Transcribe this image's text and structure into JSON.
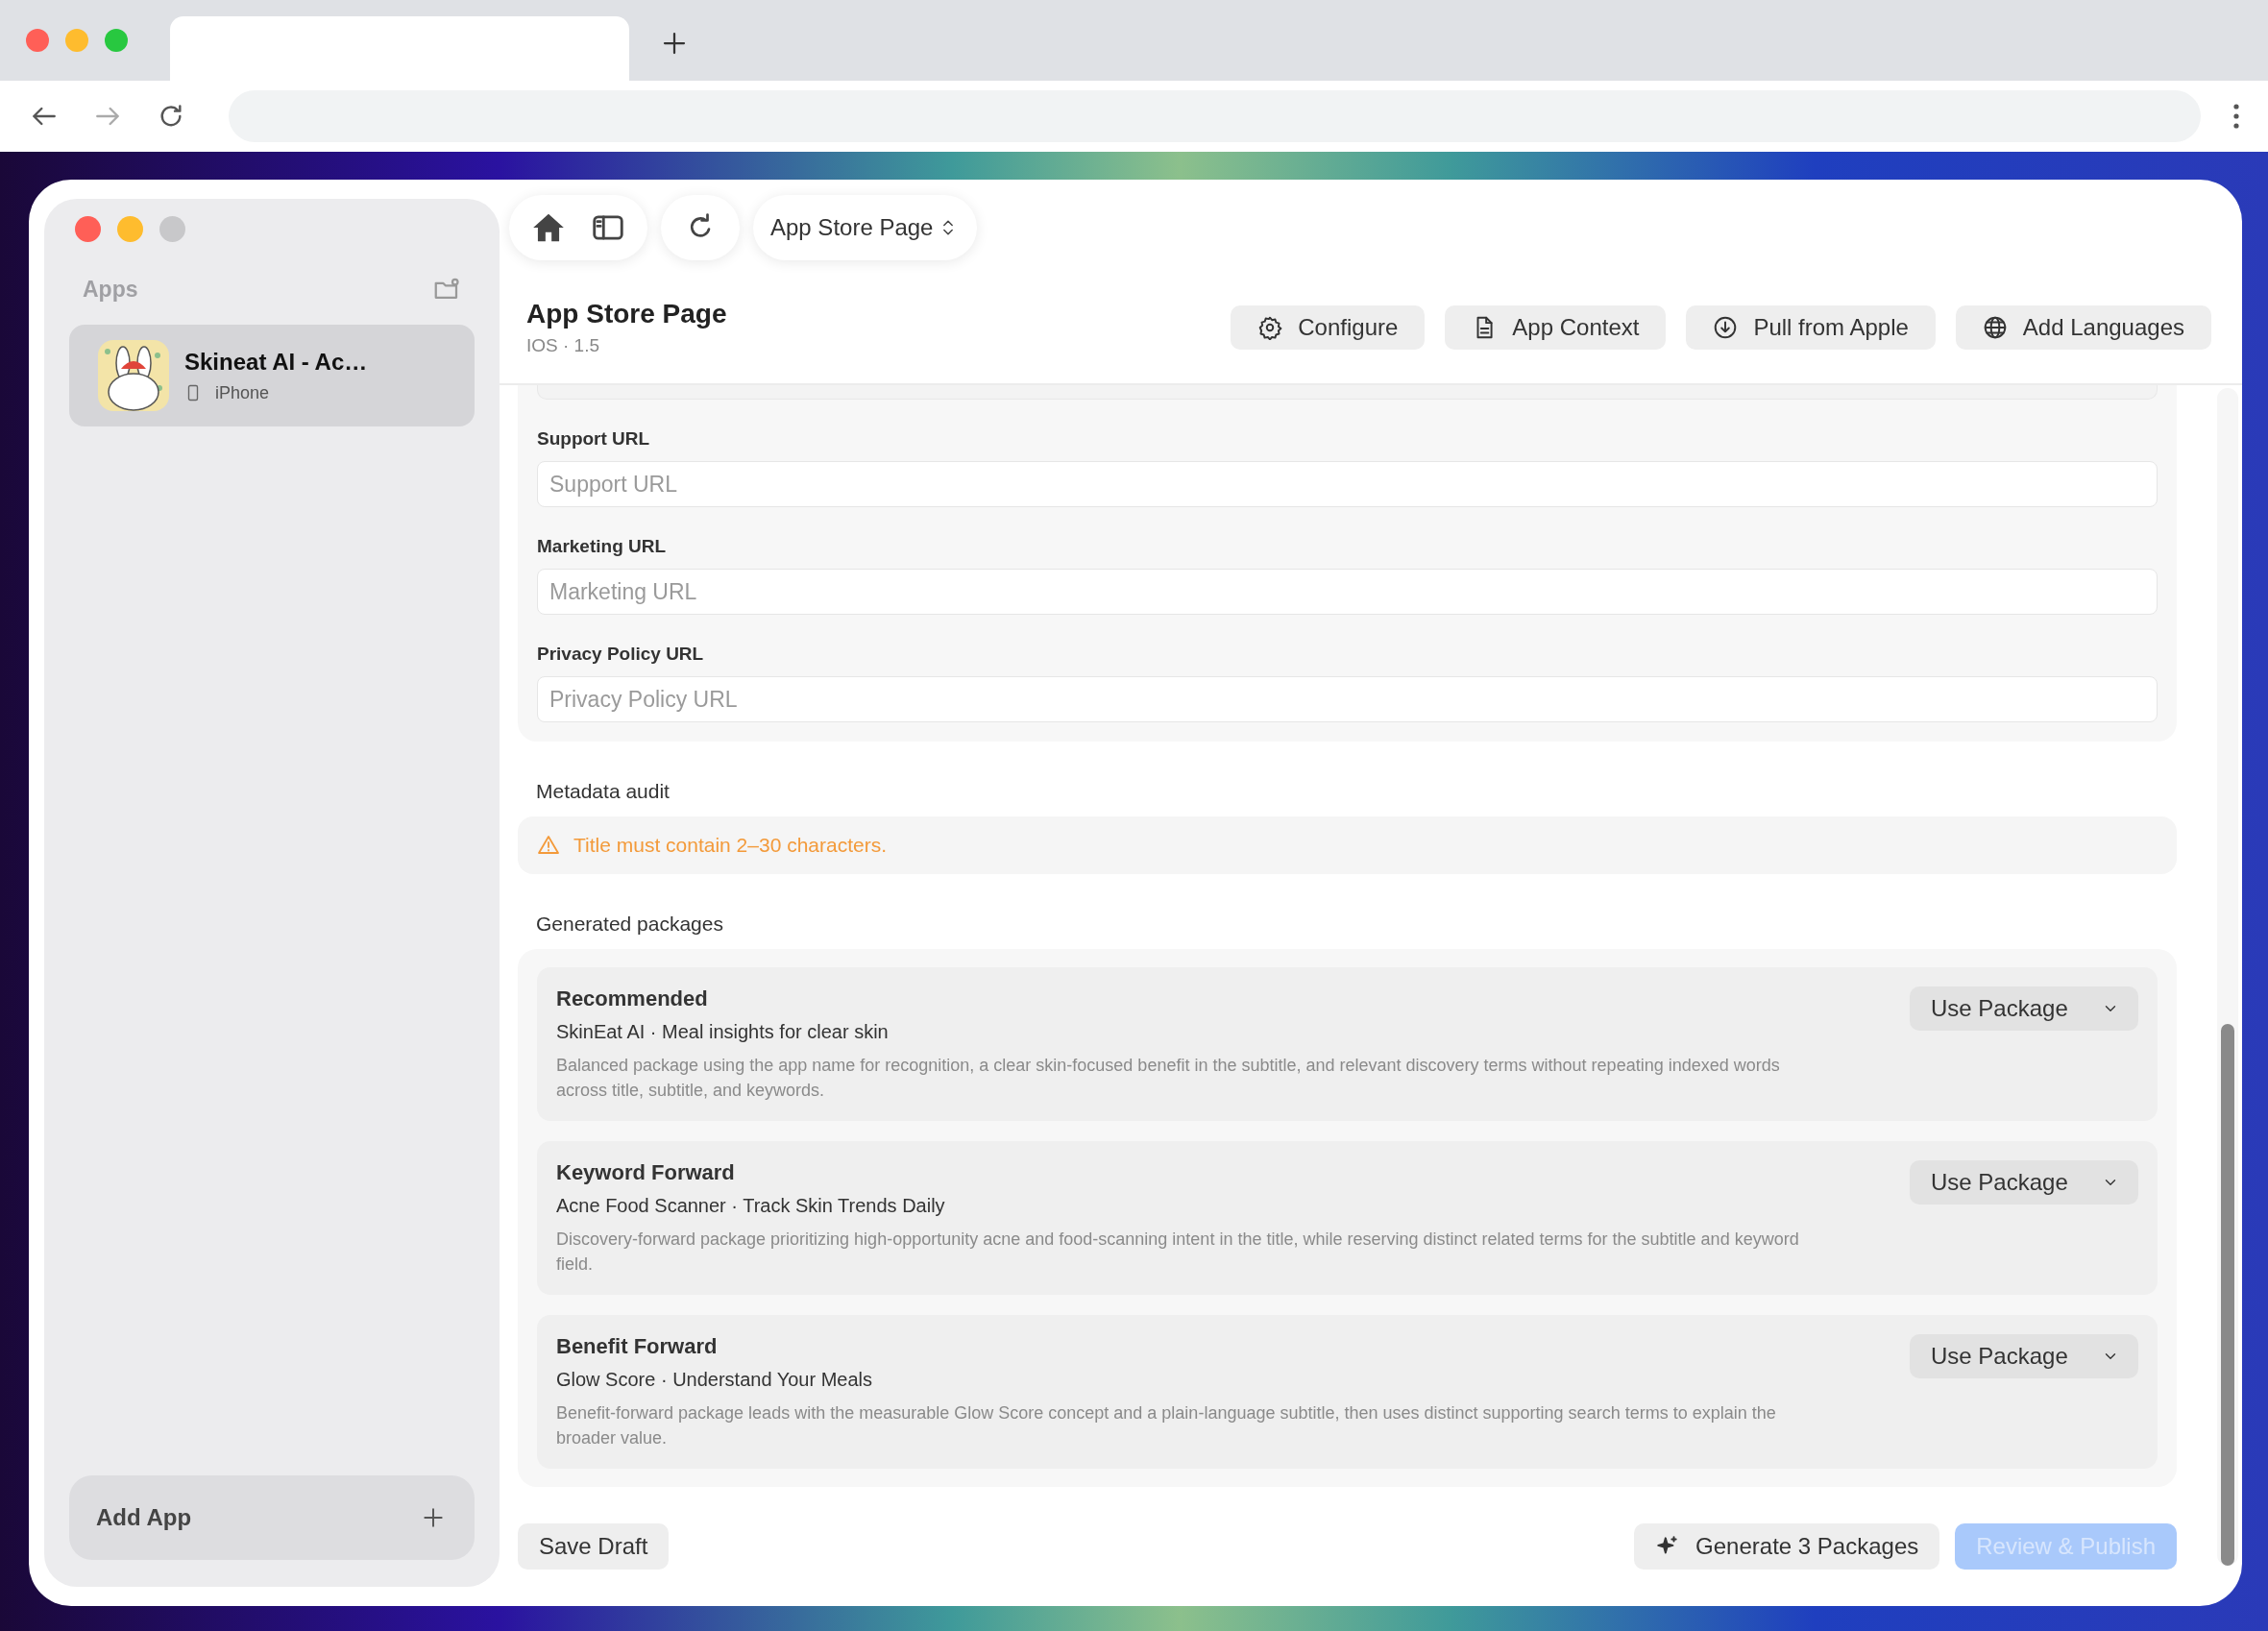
{
  "sidebar": {
    "heading": "Apps",
    "apps": [
      {
        "name": "Skineat AI - Ac…",
        "device": "iPhone",
        "selected": true
      }
    ],
    "add_button": "Add App"
  },
  "toolbar": {
    "page_picker": "App Store Page"
  },
  "header": {
    "title": "App Store Page",
    "subtitle": "IOS · 1.5",
    "actions": [
      {
        "kind": "gear",
        "label": "Configure"
      },
      {
        "kind": "document",
        "label": "App Context"
      },
      {
        "kind": "download",
        "label": "Pull from Apple"
      },
      {
        "kind": "globe",
        "label": "Add Languages"
      }
    ]
  },
  "url_fields": [
    {
      "label": "Support URL",
      "placeholder": "Support URL"
    },
    {
      "label": "Marketing URL",
      "placeholder": "Marketing URL"
    },
    {
      "label": "Privacy Policy URL",
      "placeholder": "Privacy Policy URL"
    }
  ],
  "audit": {
    "heading": "Metadata audit",
    "warnings": [
      "Title must contain 2–30 characters."
    ]
  },
  "packages": {
    "heading": "Generated packages",
    "items": [
      {
        "name": "Recommended",
        "subtitle": "SkinEat AI · Meal insights for clear skin",
        "description": "Balanced package using the app name for recognition, a clear skin-focused benefit in the subtitle, and relevant discovery terms without repeating indexed words across title, subtitle, and keywords.",
        "button": "Use Package"
      },
      {
        "name": "Keyword Forward",
        "subtitle": "Acne Food Scanner · Track Skin Trends Daily",
        "description": "Discovery-forward package prioritizing high-opportunity acne and food-scanning intent in the title, while reserving distinct related terms for the subtitle and keyword field.",
        "button": "Use Package"
      },
      {
        "name": "Benefit Forward",
        "subtitle": "Glow Score · Understand Your Meals",
        "description": "Benefit-forward package leads with the measurable Glow Score concept and a plain-language subtitle, then uses distinct supporting search terms to explain the broader value.",
        "button": "Use Package"
      }
    ]
  },
  "footer": {
    "save": "Save Draft",
    "generate": "Generate 3 Packages",
    "publish": {
      "label": "Review & Publish",
      "disabled": true
    }
  }
}
